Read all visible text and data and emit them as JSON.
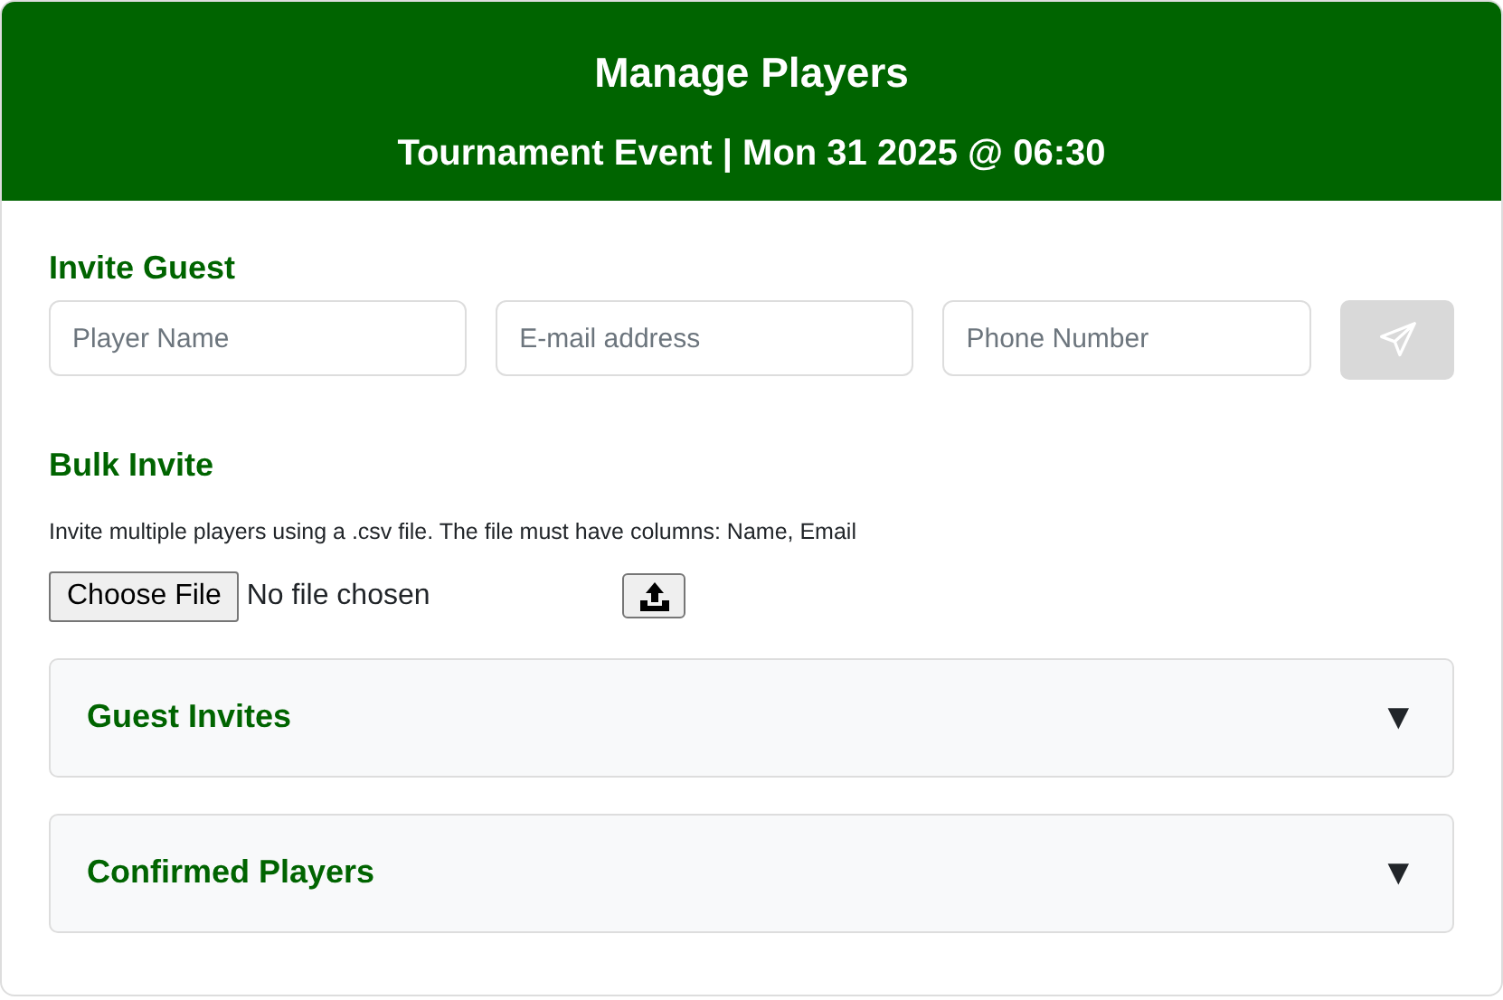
{
  "header": {
    "title": "Manage Players",
    "subtitle": "Tournament Event | Mon 31 2025 @ 06:30"
  },
  "invite_guest": {
    "heading": "Invite Guest",
    "fields": [
      {
        "placeholder": "Player Name"
      },
      {
        "placeholder": "E-mail address"
      },
      {
        "placeholder": "Phone Number"
      }
    ],
    "send_button": {
      "disabled": true
    }
  },
  "bulk_invite": {
    "heading": "Bulk Invite",
    "description": "Invite multiple players using a .csv file. The file must have columns: Name, Email",
    "choose_button": "Choose File",
    "file_status": "No file chosen"
  },
  "sections": [
    {
      "title": "Guest Invites",
      "toggle": "▼",
      "expanded": false
    },
    {
      "title": "Confirmed Players",
      "toggle": "▼",
      "expanded": false
    }
  ]
}
